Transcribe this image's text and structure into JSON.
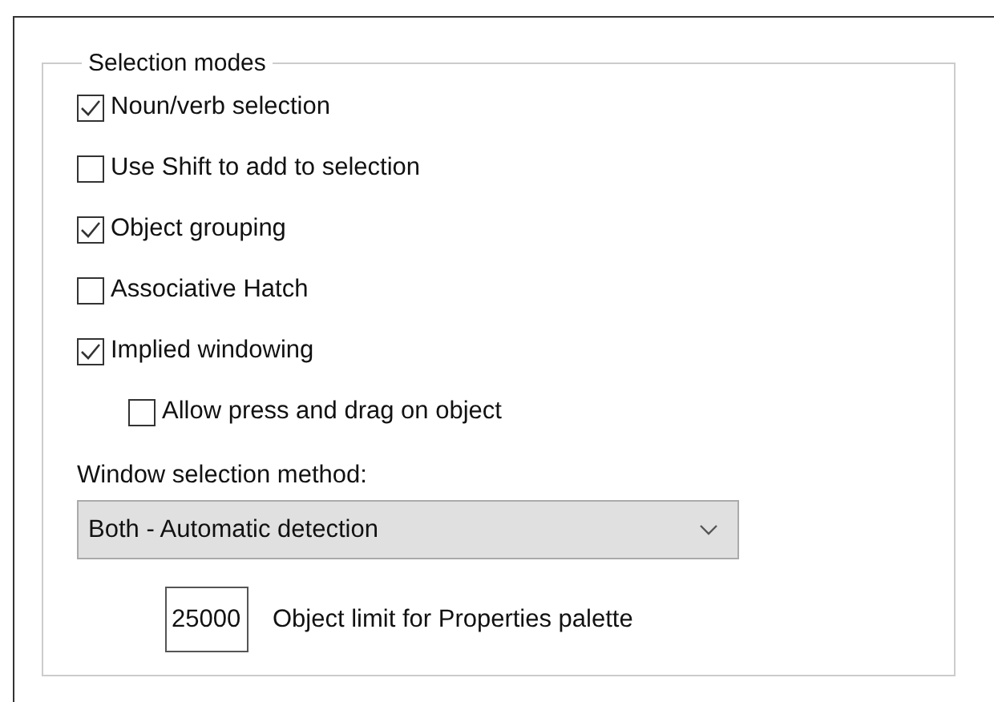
{
  "group": {
    "title": "Selection modes",
    "options": [
      {
        "label": "Noun/verb selection",
        "checked": true
      },
      {
        "label": "Use Shift to add to selection",
        "checked": false
      },
      {
        "label": "Object grouping",
        "checked": true
      },
      {
        "label": "Associative Hatch",
        "checked": false
      },
      {
        "label": "Implied windowing",
        "checked": true,
        "children": [
          {
            "label": "Allow press and drag on object",
            "checked": false
          }
        ]
      }
    ],
    "method_label": "Window selection method:",
    "method_dropdown": {
      "value": "Both - Automatic detection"
    },
    "object_limit": {
      "value": "25000",
      "label": "Object limit for Properties palette"
    }
  }
}
